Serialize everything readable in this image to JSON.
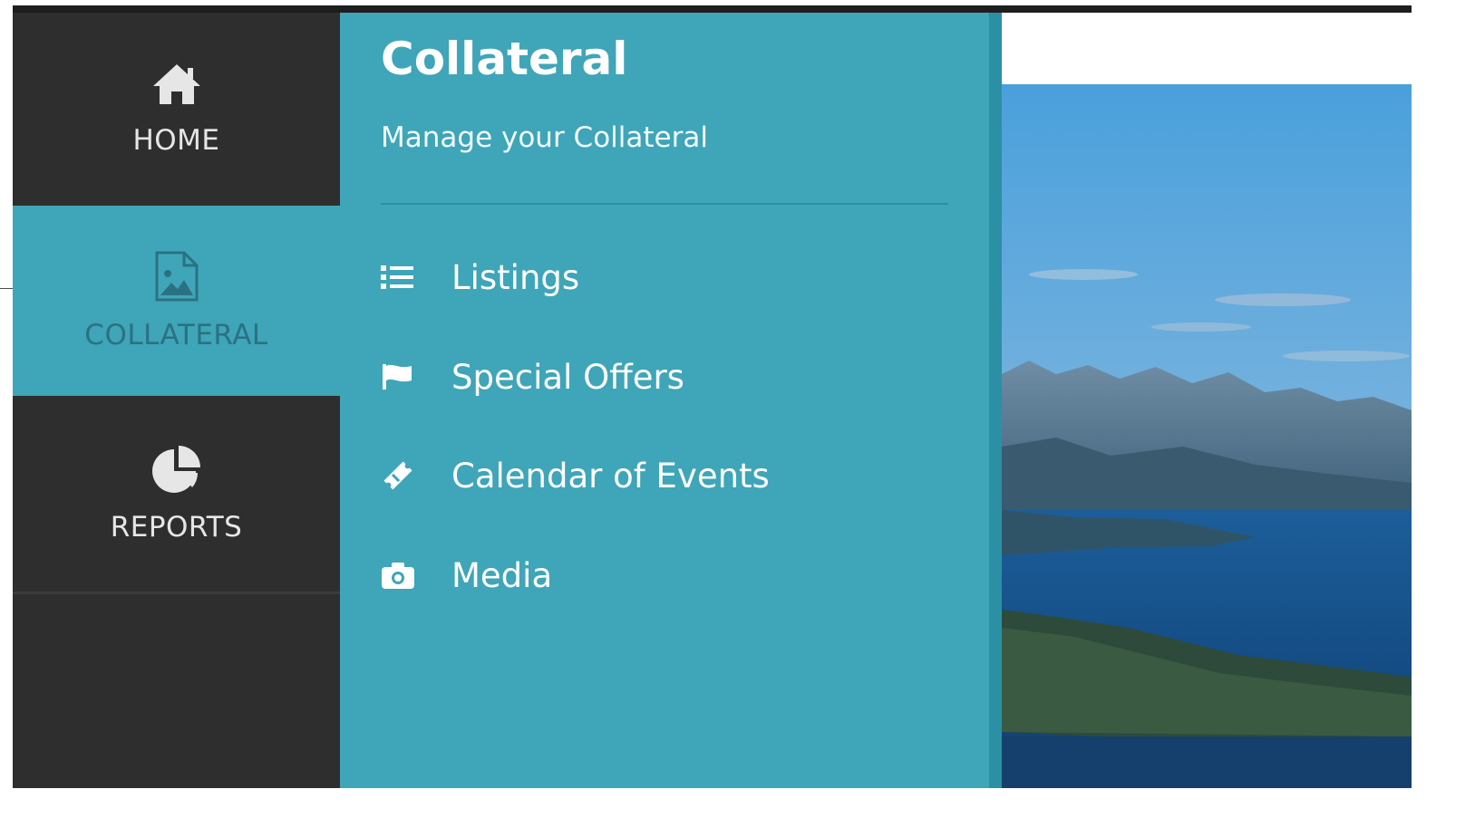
{
  "rail": {
    "items": [
      {
        "label": "HOME",
        "icon": "home-icon"
      },
      {
        "label": "COLLATERAL",
        "icon": "image-file-icon",
        "active": true
      },
      {
        "label": "REPORTS",
        "icon": "pie-chart-icon"
      }
    ]
  },
  "panel": {
    "title": "Collateral",
    "subtitle": "Manage your Collateral",
    "items": [
      {
        "label": "Listings",
        "icon": "list-icon"
      },
      {
        "label": "Special Offers",
        "icon": "flag-icon"
      },
      {
        "label": "Calendar of Events",
        "icon": "ticket-icon"
      },
      {
        "label": "Media",
        "icon": "camera-icon"
      }
    ]
  },
  "colors": {
    "rail_bg": "#2e2e2e",
    "accent": "#3fa5b8",
    "accent_dark": "#2b90a4",
    "text_light": "#ffffff"
  }
}
